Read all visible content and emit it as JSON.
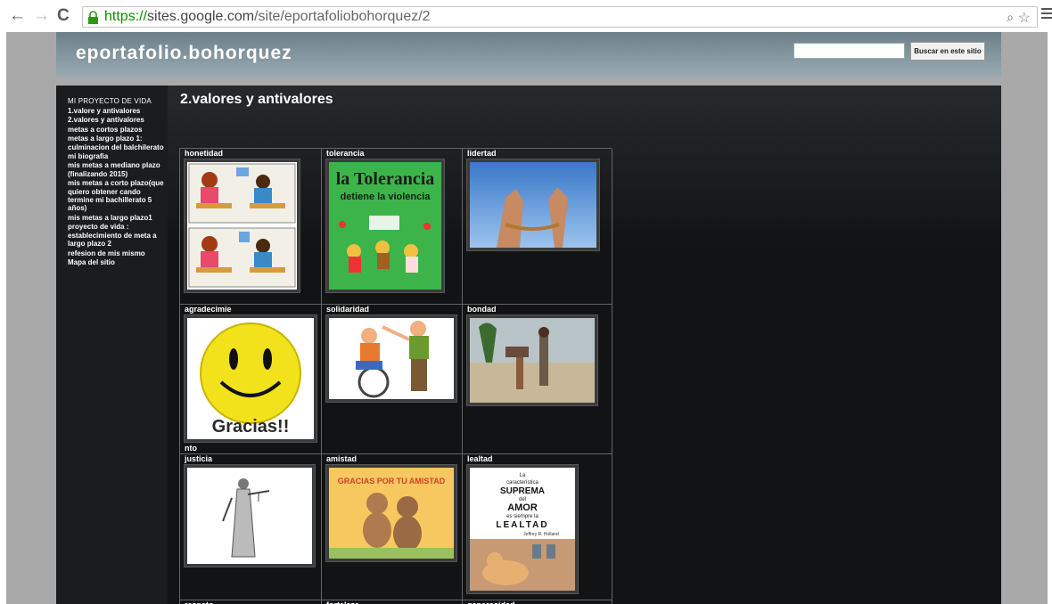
{
  "browser": {
    "url_scheme": "https://",
    "url_host": "sites.google.com",
    "url_path": "/site/eportafoliobohorquez/2"
  },
  "site": {
    "title": "eportafolio.bohorquez",
    "search_button": "Buscar en este sitio"
  },
  "sidebar": {
    "heading": "MI PROYECTO DE VIDA",
    "items": [
      "1.valore y antivalores",
      "2.valores y antivalores",
      "metas a cortos plazos",
      "metas a largo plazo 1: culminacion del balchilerato",
      "mi biografia",
      "mis metas a mediano plazo (finalizando 2015)",
      "mis metas a corto plazo(que quiero obtener cando termine mi bachillerato 5 años)",
      "mis metas a largo plazo1",
      "proyecto de vida : establecimiento de meta a largo plazo 2",
      "refesion de mis mismo",
      "Mapa del sitio"
    ]
  },
  "page": {
    "title": "2.valores y antivalores"
  },
  "values": {
    "row1": [
      "honetidad",
      "tolerancia",
      "lidertad"
    ],
    "row2": [
      "agradecimie",
      "solidaridad",
      "bondad"
    ],
    "row2_tail": "nto",
    "row3": [
      "justicia",
      "amistad",
      "lealtad"
    ],
    "row4": [
      "respeto",
      "fortaleza",
      "generosidad"
    ]
  },
  "image_text": {
    "tolerancia_1": "la Tolerancia",
    "tolerancia_2": "detiene la violencia",
    "gracias": "Gracias!!",
    "amistad": "GRACIAS POR TU AMISTAD",
    "lealtad_1": "La",
    "lealtad_2": "característica",
    "lealtad_3": "SUPREMA",
    "lealtad_4": "del",
    "lealtad_5": "AMOR",
    "lealtad_6": "es siempre la",
    "lealtad_7": "LEALTAD",
    "lealtad_8": "Jeffrey R. Holland"
  }
}
